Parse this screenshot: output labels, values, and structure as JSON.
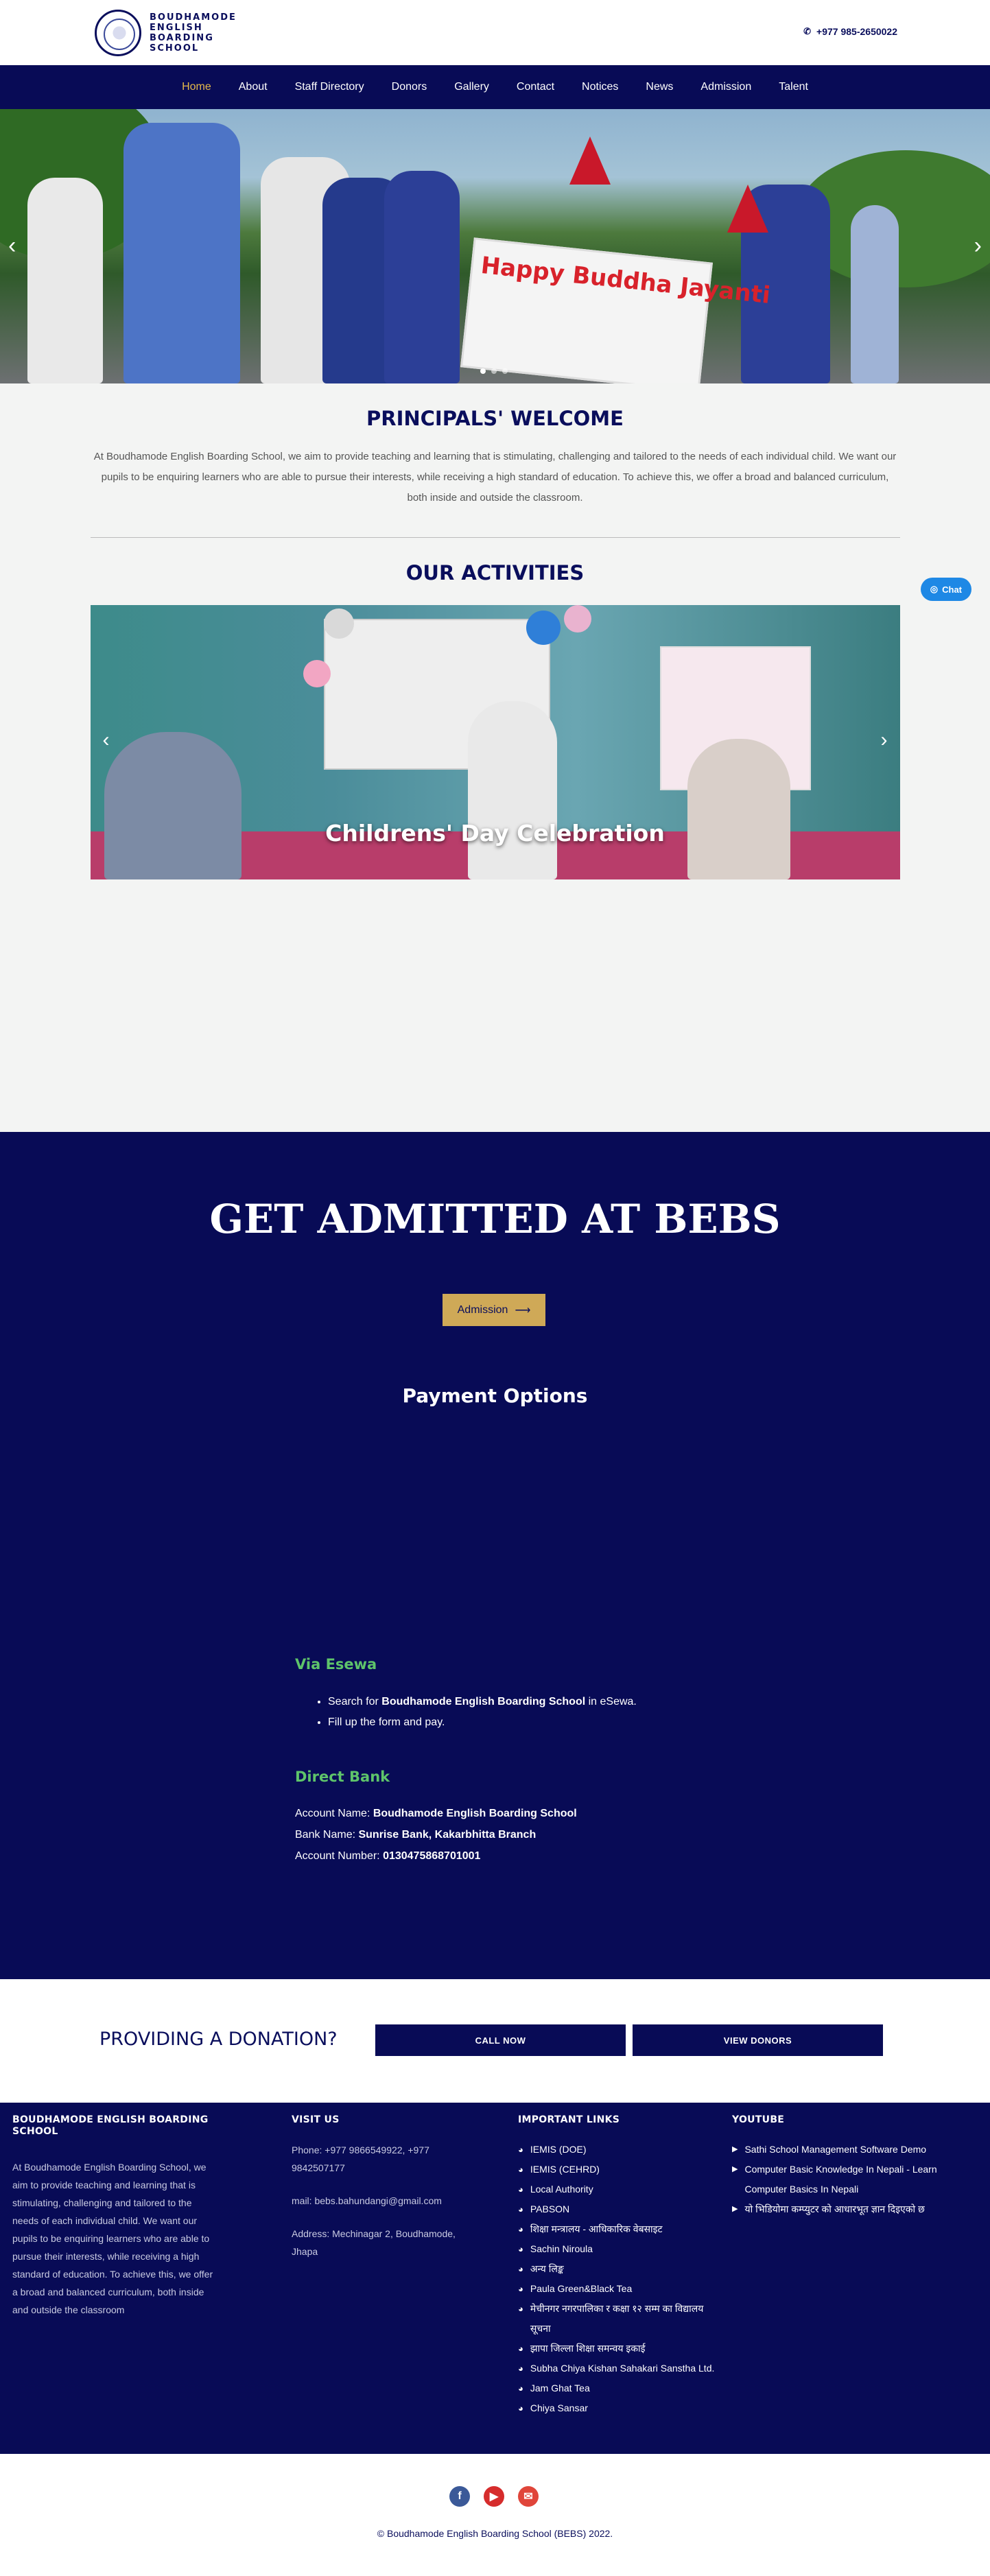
{
  "header": {
    "school_name": "BOUDHAMODE ENGLISH BOARDING SCHOOL",
    "phone": "+977 985-2650022",
    "phone_icon": "phone-icon"
  },
  "nav": {
    "items": [
      {
        "label": "Home",
        "active": true
      },
      {
        "label": "About"
      },
      {
        "label": "Staff Directory"
      },
      {
        "label": "Donors"
      },
      {
        "label": "Gallery"
      },
      {
        "label": "Contact"
      },
      {
        "label": "Notices"
      },
      {
        "label": "News"
      },
      {
        "label": "Admission"
      },
      {
        "label": "Talent"
      }
    ]
  },
  "hero": {
    "banner_text": "Happy Buddha Jayanti",
    "slides": 3,
    "active_slide": 1
  },
  "welcome": {
    "title": "PRINCIPALS' WELCOME",
    "text": "At Boudhamode English Boarding School, we aim to provide teaching and learning that is stimulating, challenging and tailored to the needs of each individual child. We want our pupils to be enquiring learners who are able to pursue their interests, while receiving a high standard of education. To achieve this, we offer a broad and balanced curriculum, both inside and outside the classroom."
  },
  "activities": {
    "title": "OUR ACTIVITIES",
    "caption": "Childrens' Day Celebration"
  },
  "chat": {
    "label": "Chat"
  },
  "admission": {
    "title": "GET ADMITTED AT BEBS",
    "button": "Admission",
    "payment_title": "Payment Options",
    "esewa": {
      "heading": "Via Esewa",
      "line1_pre": "Search for ",
      "line1_bold": "Boudhamode English Boarding School",
      "line1_post": " in eSewa.",
      "line2": "Fill up the form and pay."
    },
    "bank": {
      "heading": "Direct Bank",
      "account_name_label": "Account Name: ",
      "account_name": "Boudhamode English Boarding School",
      "bank_name_label": "Bank Name: ",
      "bank_name": "Sunrise Bank, Kakarbhitta Branch",
      "account_number_label": "Account Number: ",
      "account_number": "0130475868701001"
    }
  },
  "donation": {
    "title": "PROVIDING A DONATION?",
    "call": "CALL NOW",
    "view": "VIEW DONORS"
  },
  "footer": {
    "about_title": "BOUDHAMODE ENGLISH BOARDING SCHOOL",
    "about_text": "At Boudhamode English Boarding School, we aim to provide teaching and learning that is stimulating, challenging and tailored to the needs of each individual child. We want our pupils to be enquiring learners who are able to pursue their interests, while receiving a high standard of education. To achieve this, we offer a broad and balanced curriculum, both inside and outside the classroom",
    "visit_title": "VISIT US",
    "phone": "Phone: +977 9866549922, +977 9842507177",
    "mail": "mail: bebs.bahundangi@gmail.com",
    "address": "Address: Mechinagar 2, Boudhamode, Jhapa",
    "links_title": "IMPORTANT LINKS",
    "links": [
      "IEMIS (DOE)",
      "IEMIS (CEHRD)",
      "Local Authority",
      "PABSON",
      "शिक्षा मन्त्रालय - आधिकारिक वेबसाइट",
      "Sachin Niroula",
      "अन्य लिङ्क",
      "Paula Green&Black Tea",
      "मेचीनगर नगरपालिका र कक्षा १२ सम्म का विद्यालय सूचना",
      "झापा जिल्ला शिक्षा समन्वय इकाई",
      "Subha Chiya Kishan Sahakari Sanstha Ltd.",
      "Jam Ghat Tea",
      "Chiya Sansar"
    ],
    "youtube_title": "YOUTUBE",
    "youtube": [
      "Sathi School Management Software Demo",
      "Computer Basic Knowledge In Nepali - Learn Computer Basics In Nepali",
      "यो भिडियोमा कम्प्युटर को आधारभूत ज्ञान दिइएको छ"
    ]
  },
  "bottom": {
    "social": [
      "facebook-icon",
      "youtube-icon",
      "email-icon"
    ],
    "copyright": "© Boudhamode English Boarding School (BEBS) 2022."
  }
}
